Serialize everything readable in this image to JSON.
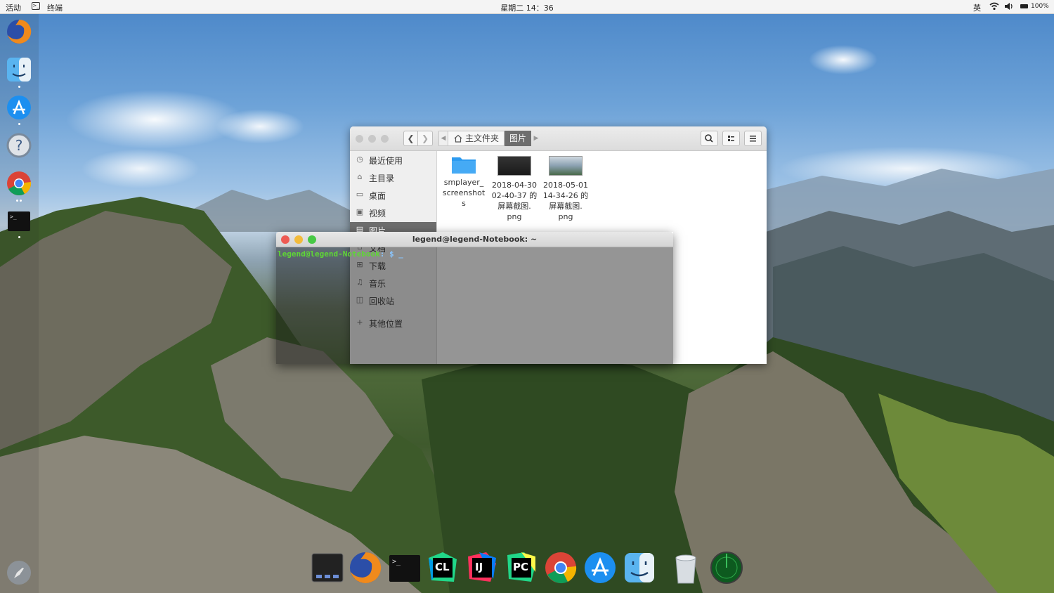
{
  "topbar": {
    "activities": "活动",
    "app_name": "终端",
    "clock": "星期二 14：36",
    "ime": "英",
    "battery": "100%"
  },
  "left_dock": {
    "items": [
      "firefox-icon",
      "finder-icon",
      "app-store-icon",
      "help-icon",
      "chrome-icon",
      "terminal-icon"
    ],
    "launcher": "rocket-icon"
  },
  "files_window": {
    "breadcrumb": {
      "home": "主文件夹",
      "current": "图片"
    },
    "sidebar": [
      {
        "label": "最近使用",
        "icon": "clock-icon"
      },
      {
        "label": "主目录",
        "icon": "home-icon"
      },
      {
        "label": "桌面",
        "icon": "desktop-icon"
      },
      {
        "label": "视频",
        "icon": "video-icon"
      },
      {
        "label": "图片",
        "icon": "image-icon"
      },
      {
        "label": "文档",
        "icon": "document-icon"
      },
      {
        "label": "下载",
        "icon": "download-icon"
      },
      {
        "label": "音乐",
        "icon": "music-icon"
      },
      {
        "label": "回收站",
        "icon": "trash-icon"
      },
      {
        "label": "其他位置",
        "icon": "plus-icon"
      }
    ],
    "files": [
      {
        "line1": "smplayer_",
        "line2": "screenshot",
        "line3": "s",
        "type": "folder"
      },
      {
        "line1": "2018-04-30",
        "line2": "02-40-37 的",
        "line3": "屏幕截图.",
        "line4": "png",
        "type": "image"
      },
      {
        "line1": "2018-05-01",
        "line2": "14-34-26 的",
        "line3": "屏幕截图.",
        "line4": "png",
        "type": "image"
      }
    ]
  },
  "terminal": {
    "title": "legend@legend-Notebook: ~",
    "prompt_user": "legend@legend-Notebook",
    "prompt_suffix": ": $ _"
  },
  "bottom_dock": {
    "items": [
      "workspace-icon",
      "firefox-icon",
      "terminal-icon",
      "clion-icon",
      "intellij-icon",
      "pycharm-icon",
      "chrome-icon",
      "app-store-icon",
      "finder-icon",
      "trash-icon",
      "radar-icon"
    ],
    "labels": {
      "clion": "CL",
      "intellij": "IJ",
      "pycharm": "PC"
    }
  }
}
